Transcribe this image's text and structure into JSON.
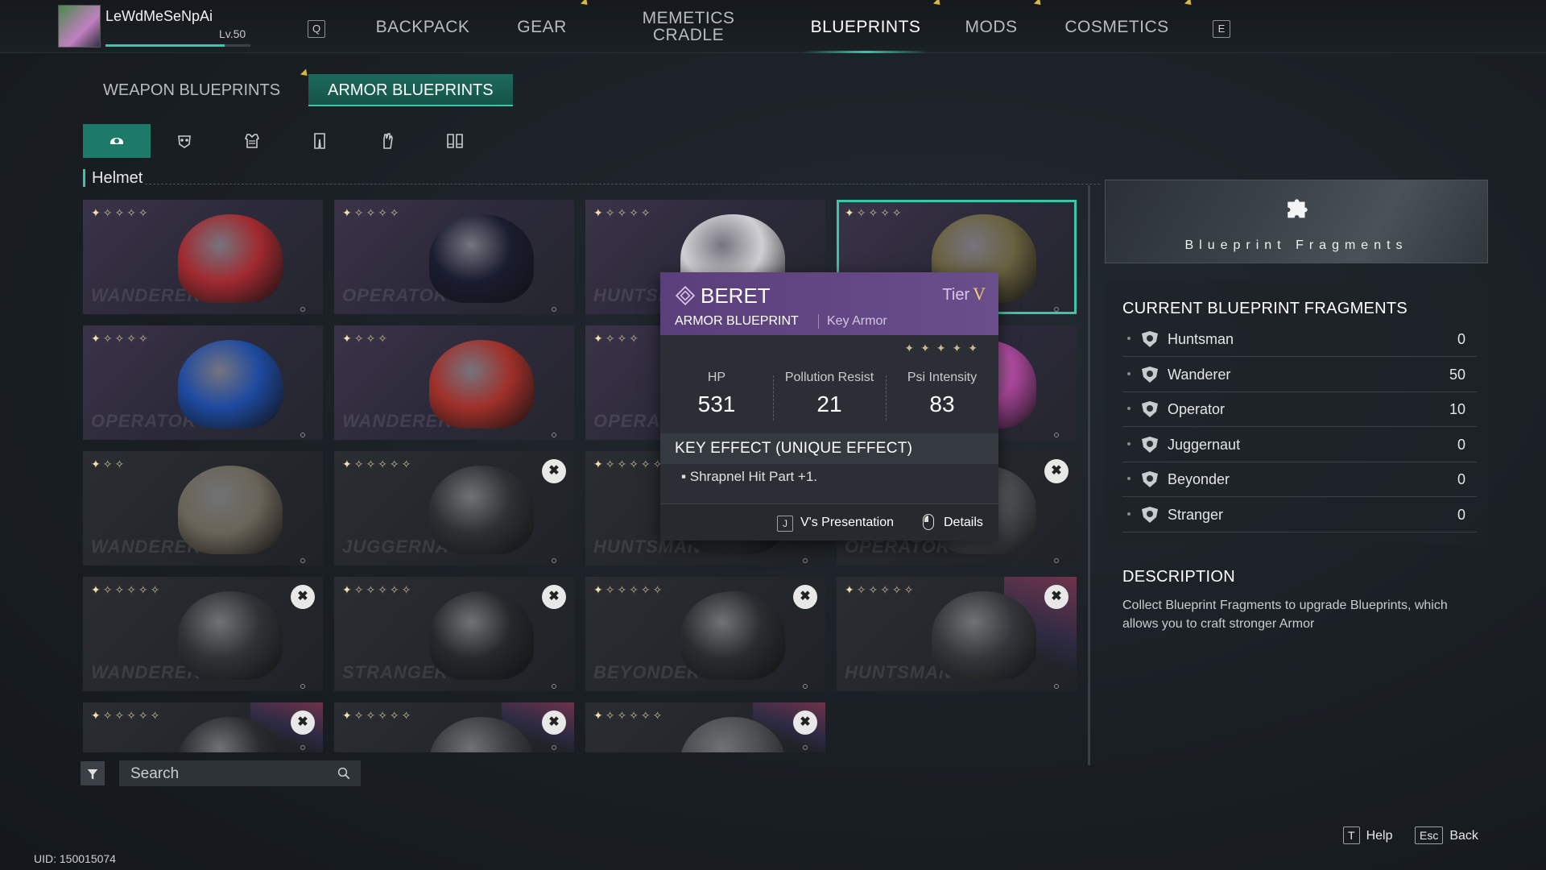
{
  "player": {
    "name": "LeWdMeSeNpAi",
    "level": "Lv.50",
    "xp_fraction": 0.82
  },
  "nav": {
    "left_key": "Q",
    "right_key": "E",
    "items": [
      {
        "label": "BACKPACK"
      },
      {
        "label": "GEAR"
      },
      {
        "label": "MEMETICS\nCRADLE"
      },
      {
        "label": "BLUEPRINTS"
      },
      {
        "label": "MODS"
      },
      {
        "label": "COSMETICS"
      }
    ],
    "active": "BLUEPRINTS"
  },
  "tabs": {
    "weapon": "WEAPON BLUEPRINTS",
    "armor": "ARMOR BLUEPRINTS",
    "active": "armor"
  },
  "categories": [
    "helmet-icon",
    "mask-icon",
    "chest-icon",
    "legs-icon",
    "gloves-icon",
    "boots-icon"
  ],
  "section_label": "Helmet",
  "grid": [
    {
      "label": "WANDERER",
      "stars": 5,
      "locked": false,
      "item_color": "#a02a30",
      "dim": false
    },
    {
      "label": "OPERATOR",
      "stars": 5,
      "locked": false,
      "item_color": "#1a1c30",
      "dim": false
    },
    {
      "label": "HUNTSMAN",
      "stars": 5,
      "locked": false,
      "item_color": "#d0d0d4",
      "dim": false
    },
    {
      "label": "",
      "stars": 5,
      "locked": false,
      "item_color": "#6a6240",
      "dim": false,
      "selected": true
    },
    {
      "label": "OPERATOR",
      "stars": 5,
      "locked": false,
      "item_color": "#1e4aa0",
      "dim": false
    },
    {
      "label": "WANDERER",
      "stars": 4,
      "locked": false,
      "item_color": "#a0302a",
      "dim": false
    },
    {
      "label": "OPERATOR",
      "stars": 4,
      "locked": false,
      "item_color": "#3a3a4a",
      "dim": false
    },
    {
      "label": "",
      "stars": 5,
      "locked": false,
      "item_color": "#b04aa0",
      "dim": false
    },
    {
      "label": "WANDERER",
      "stars": 3,
      "locked": false,
      "item_color": "#6a6458",
      "dim": true
    },
    {
      "label": "JUGGERNAUT",
      "stars": 6,
      "locked": true,
      "item_color": "#2e3034",
      "dim": true
    },
    {
      "label": "HUNTSMAN",
      "stars": 6,
      "locked": true,
      "item_color": "#2e3034",
      "dim": true
    },
    {
      "label": "OPERATOR",
      "stars": 6,
      "locked": true,
      "item_color": "#4a4c50",
      "dim": true
    },
    {
      "label": "WANDERER",
      "stars": 6,
      "locked": true,
      "item_color": "#303236",
      "dim": true
    },
    {
      "label": "STRANGER",
      "stars": 6,
      "locked": true,
      "item_color": "#26282c",
      "dim": true
    },
    {
      "label": "BEYONDER",
      "stars": 6,
      "locked": true,
      "item_color": "#2a2c30",
      "dim": true
    },
    {
      "label": "HUNTSMAN",
      "stars": 6,
      "locked": true,
      "item_color": "#34363a",
      "dim": true,
      "glint": true
    },
    {
      "label": "",
      "stars": 6,
      "locked": true,
      "item_color": "#2a2c30",
      "dim": true,
      "glint": true
    },
    {
      "label": "",
      "stars": 6,
      "locked": true,
      "item_color": "#3a3c40",
      "dim": true,
      "glint": true
    },
    {
      "label": "",
      "stars": 6,
      "locked": true,
      "item_color": "#4a4c50",
      "dim": true,
      "glint": true
    }
  ],
  "tooltip": {
    "name": "BERET",
    "tier_label": "Tier",
    "tier_value": "V",
    "type": "ARMOR BLUEPRINT",
    "subtype": "Key Armor",
    "stars": 5,
    "stats": [
      {
        "label": "HP",
        "value": "531"
      },
      {
        "label": "Pollution Resist",
        "value": "21"
      },
      {
        "label": "Psi Intensity",
        "value": "83"
      }
    ],
    "key_effect_title": "KEY EFFECT (UNIQUE EFFECT)",
    "key_effect": "Shrapnel Hit Part +1.",
    "presentation_key": "J",
    "presentation_label": "V's Presentation",
    "details_label": "Details"
  },
  "fragments": {
    "banner": "Blueprint Fragments",
    "title": "CURRENT BLUEPRINT FRAGMENTS",
    "rows": [
      {
        "name": "Huntsman",
        "value": "0"
      },
      {
        "name": "Wanderer",
        "value": "50"
      },
      {
        "name": "Operator",
        "value": "10"
      },
      {
        "name": "Juggernaut",
        "value": "0"
      },
      {
        "name": "Beyonder",
        "value": "0"
      },
      {
        "name": "Stranger",
        "value": "0"
      }
    ]
  },
  "description": {
    "title": "DESCRIPTION",
    "text": "Collect Blueprint Fragments to upgrade Blueprints, which allows you to craft stronger Armor"
  },
  "search": {
    "placeholder": "Search"
  },
  "footer": {
    "help_key": "T",
    "help_label": "Help",
    "back_key": "Esc",
    "back_label": "Back",
    "uid": "UID: 150015074"
  },
  "colors": {
    "accent": "#3ec4a8",
    "tooltip_header": "#6a4e8c",
    "tier": "#f0d070"
  }
}
